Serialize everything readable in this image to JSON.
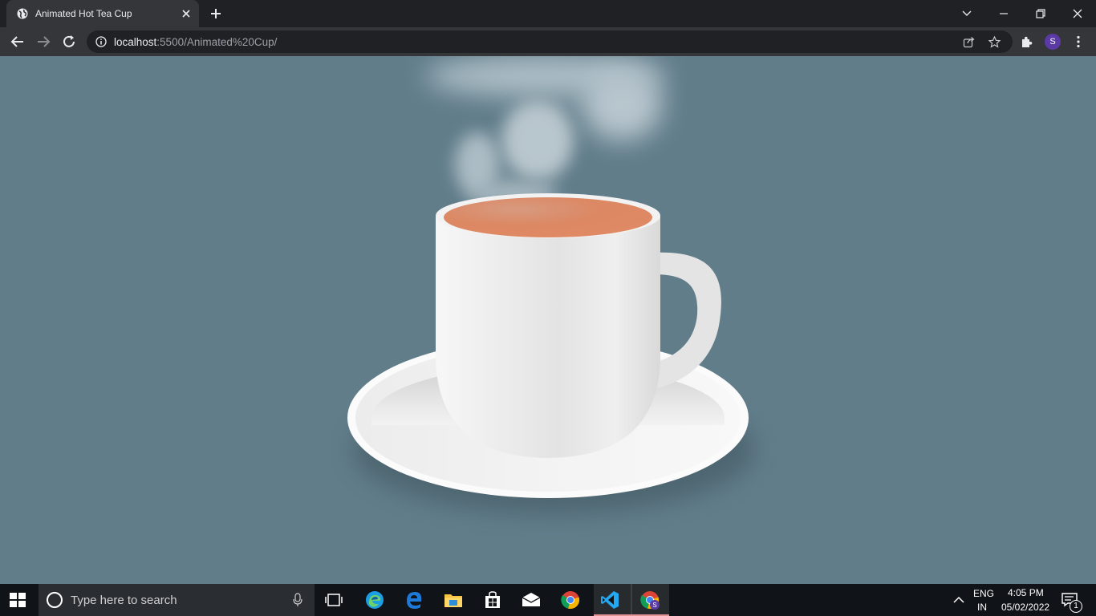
{
  "browser": {
    "tab": {
      "title": "Animated Hot Tea Cup"
    },
    "address": {
      "host": "localhost",
      "path": ":5500/Animated%20Cup/"
    },
    "profile": {
      "initial": "S"
    }
  },
  "page": {
    "colors": {
      "background": "#617d8a",
      "tea": "#e08a64",
      "cup": "#f0f0f0",
      "saucer": "#f4f4f4",
      "steam": "#d7e0e5"
    }
  },
  "taskbar": {
    "search_placeholder": "Type here to search",
    "apps": [
      "task-view",
      "edge",
      "edge-legacy",
      "file-explorer",
      "microsoft-store",
      "mail",
      "chrome",
      "vscode",
      "chrome-profile"
    ],
    "tray": {
      "language_line1": "ENG",
      "language_line2": "IN",
      "time": "4:05 PM",
      "date": "05/02/2022",
      "notification_count": "1"
    }
  }
}
